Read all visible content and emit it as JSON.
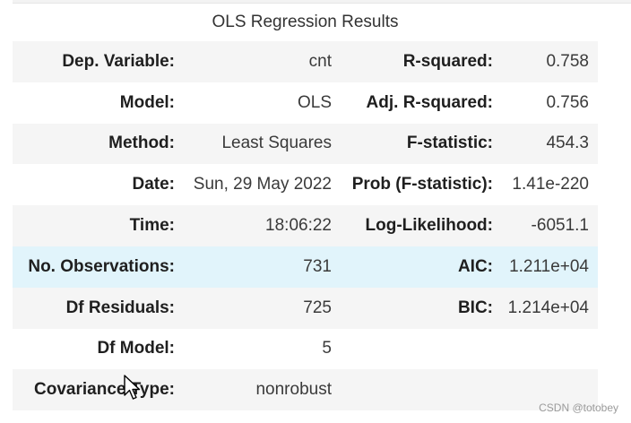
{
  "caption": "OLS Regression Results",
  "rows": [
    {
      "h1": "Dep. Variable:",
      "v1": "cnt",
      "h2": "R-squared:",
      "v2": "0.758"
    },
    {
      "h1": "Model:",
      "v1": "OLS",
      "h2": "Adj. R-squared:",
      "v2": "0.756"
    },
    {
      "h1": "Method:",
      "v1": "Least Squares",
      "h2": "F-statistic:",
      "v2": "454.3"
    },
    {
      "h1": "Date:",
      "v1": "Sun, 29 May 2022",
      "h2": "Prob (F-statistic):",
      "v2": "1.41e-220"
    },
    {
      "h1": "Time:",
      "v1": "18:06:22",
      "h2": "Log-Likelihood:",
      "v2": "-6051.1"
    },
    {
      "h1": "No. Observations:",
      "v1": "731",
      "h2": "AIC:",
      "v2": "1.211e+04"
    },
    {
      "h1": "Df Residuals:",
      "v1": "725",
      "h2": "BIC:",
      "v2": "1.214e+04"
    },
    {
      "h1": "Df Model:",
      "v1": "5",
      "h2": "",
      "v2": ""
    },
    {
      "h1": "Covariance Type:",
      "v1": "nonrobust",
      "h2": "",
      "v2": ""
    }
  ],
  "watermark": "CSDN @totobey",
  "colors": {
    "row_stripe": "#f5f5f5",
    "row_hover": "#e1f4fb"
  },
  "icons": {
    "cursor": "mouse-pointer-icon"
  }
}
